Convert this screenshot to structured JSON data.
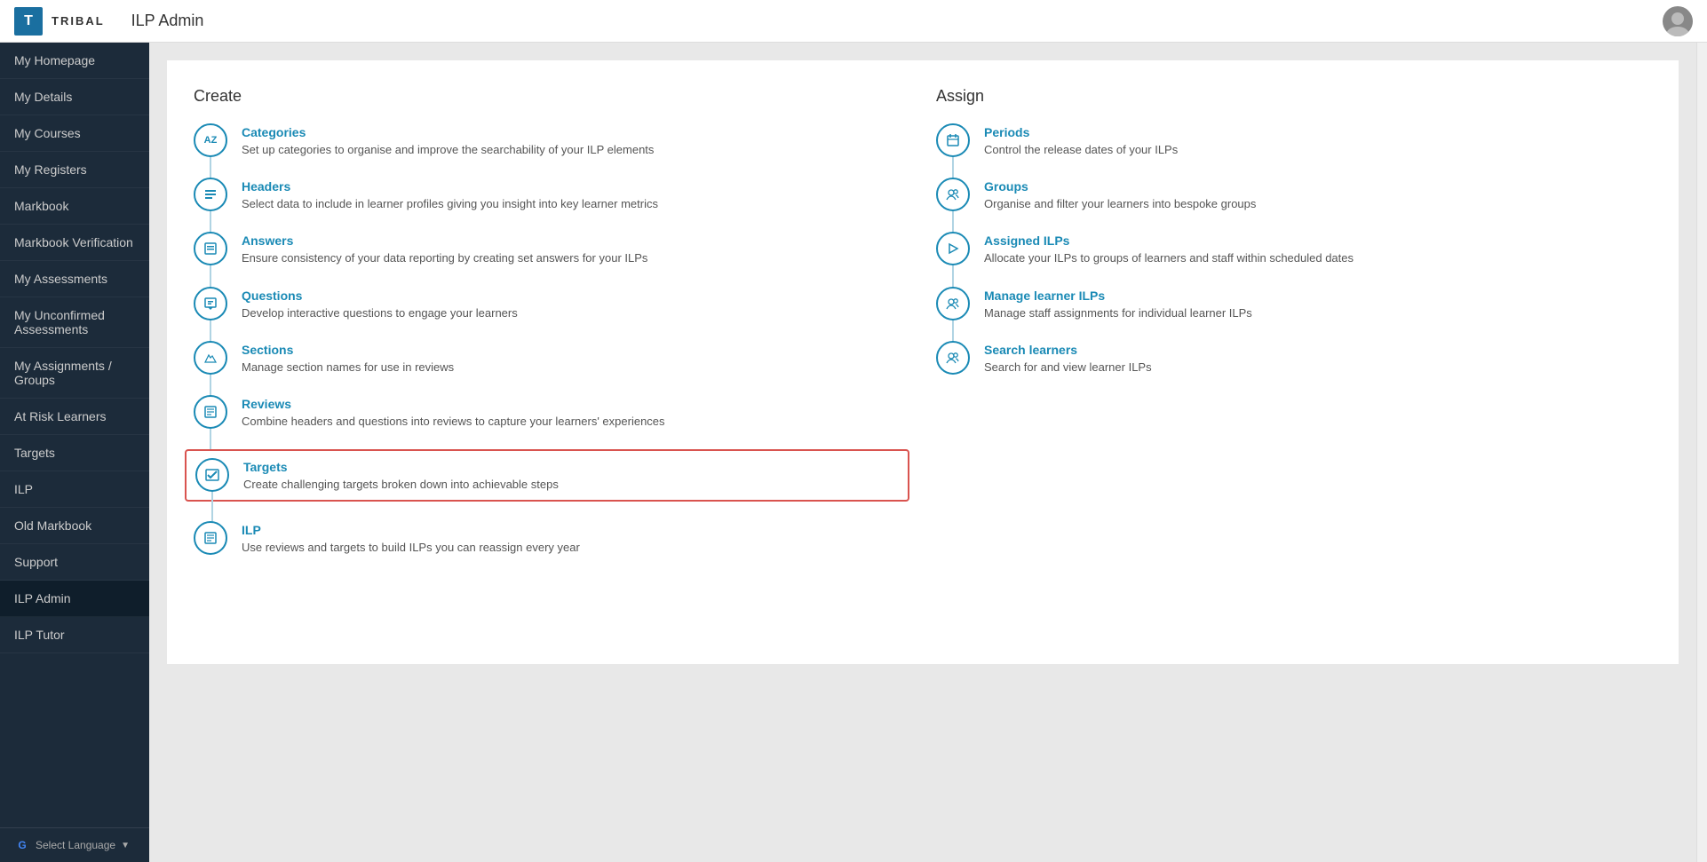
{
  "header": {
    "logo_letter": "T",
    "brand": "TRIBAL",
    "page_title": "ILP Admin"
  },
  "sidebar": {
    "items": [
      {
        "label": "My Homepage",
        "active": false
      },
      {
        "label": "My Details",
        "active": false
      },
      {
        "label": "My Courses",
        "active": false
      },
      {
        "label": "My Registers",
        "active": false
      },
      {
        "label": "Markbook",
        "active": false
      },
      {
        "label": "Markbook Verification",
        "active": false
      },
      {
        "label": "My Assessments",
        "active": false
      },
      {
        "label": "My Unconfirmed Assessments",
        "active": false
      },
      {
        "label": "My Assignments / Groups",
        "active": false
      },
      {
        "label": "At Risk Learners",
        "active": false
      },
      {
        "label": "Targets",
        "active": false
      },
      {
        "label": "ILP",
        "active": false
      },
      {
        "label": "Old Markbook",
        "active": false
      },
      {
        "label": "Support",
        "active": false
      },
      {
        "label": "ILP Admin",
        "active": true
      },
      {
        "label": "ILP Tutor",
        "active": false
      }
    ],
    "footer_label": "Select Language"
  },
  "main": {
    "create_section": {
      "title": "Create",
      "items": [
        {
          "link": "Categories",
          "desc": "Set up categories to organise and improve the searchability of your ILP elements",
          "icon": "AZ"
        },
        {
          "link": "Headers",
          "desc": "Select data to include in learner profiles giving you insight into key learner metrics",
          "icon": "☰"
        },
        {
          "link": "Answers",
          "desc": "Ensure consistency of your data reporting by creating set answers for your ILPs",
          "icon": "▣"
        },
        {
          "link": "Questions",
          "desc": "Develop interactive questions to engage your learners",
          "icon": "?"
        },
        {
          "link": "Sections",
          "desc": "Manage section names for use in reviews",
          "icon": "📁"
        },
        {
          "link": "Reviews",
          "desc": "Combine headers and questions into reviews to capture your learners' experiences",
          "icon": "📋"
        },
        {
          "link": "Targets",
          "desc": "Create challenging targets broken down into achievable steps",
          "icon": "✓",
          "highlighted": true
        },
        {
          "link": "ILP",
          "desc": "Use reviews and targets to build ILPs you can reassign every year",
          "icon": "☰"
        }
      ]
    },
    "assign_section": {
      "title": "Assign",
      "items": [
        {
          "link": "Periods",
          "desc": "Control the release dates of your ILPs",
          "icon": "📅"
        },
        {
          "link": "Groups",
          "desc": "Organise and filter your learners into bespoke groups",
          "icon": "👥"
        },
        {
          "link": "Assigned ILPs",
          "desc": "Allocate your ILPs to groups of learners and staff within scheduled dates",
          "icon": "▶"
        },
        {
          "link": "Manage learner ILPs",
          "desc": "Manage staff assignments for individual learner ILPs",
          "icon": "👥"
        },
        {
          "link": "Search learners",
          "desc": "Search for and view learner ILPs",
          "icon": "👥"
        }
      ]
    }
  }
}
